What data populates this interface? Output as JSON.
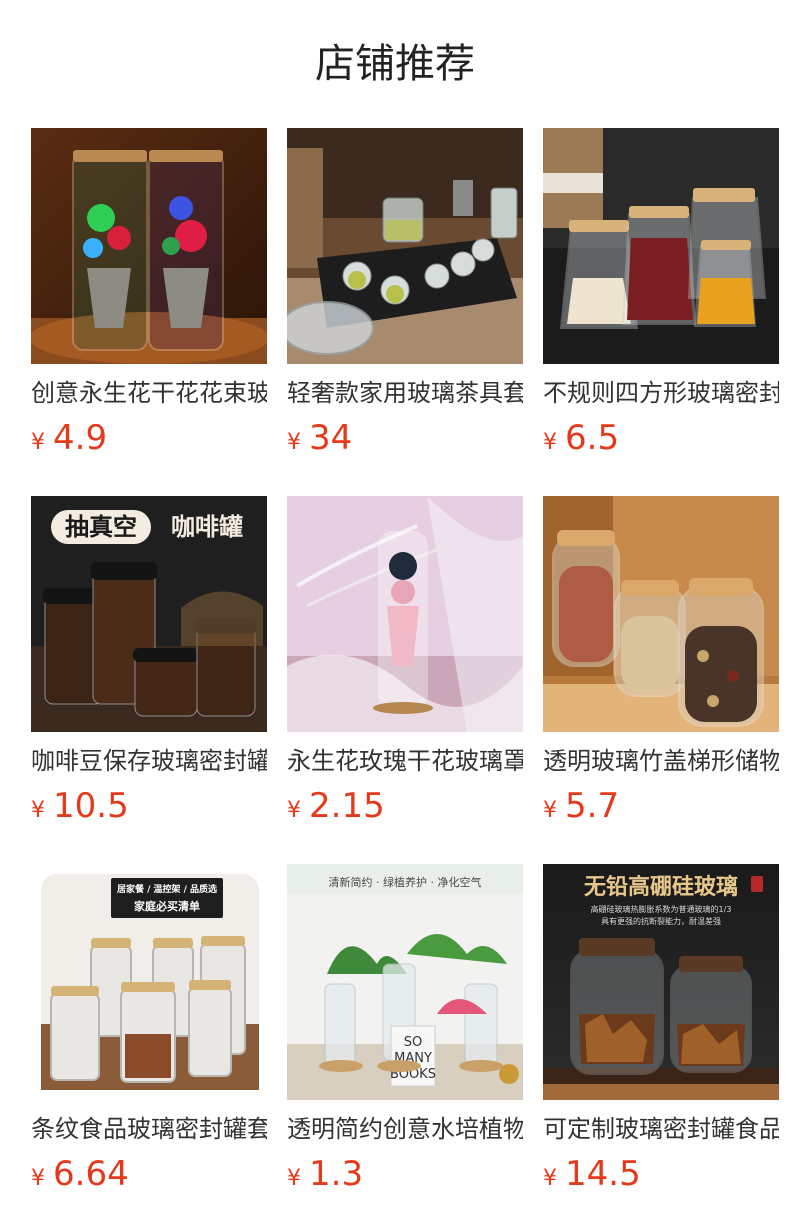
{
  "section": {
    "title": "店铺推荐"
  },
  "currency_symbol": "¥",
  "colors": {
    "price": "#e4391b",
    "text": "#333333",
    "background": "#ffffff"
  },
  "products": [
    {
      "name": "创意永生花干花花束玻璃罩",
      "price": "4.9",
      "image": "preserved-flower-bouquet-jars"
    },
    {
      "name": "轻奢款家用玻璃茶具套装",
      "price": "34",
      "image": "glass-tea-set-on-tray"
    },
    {
      "name": "不规则四方形玻璃密封罐",
      "price": "6.5",
      "image": "square-glass-jars-bamboo-lids"
    },
    {
      "name": "咖啡豆保存玻璃密封罐",
      "price": "10.5",
      "image": "coffee-bean-vacuum-jars",
      "banner_left": "抽真空",
      "banner_right": "咖啡罐"
    },
    {
      "name": "永生花玫瑰干花玻璃罩",
      "price": "2.15",
      "image": "pink-rose-in-glass-tube"
    },
    {
      "name": "透明玻璃竹盖梯形储物罐",
      "price": "5.7",
      "image": "nut-storage-jars"
    },
    {
      "name": "条纹食品玻璃密封罐套装",
      "price": "6.64",
      "image": "striped-glass-jars",
      "tag_line1": "居家餐 / 温控架 / 品质选",
      "tag_line2": "家庭必买清单"
    },
    {
      "name": "透明简约创意水培植物瓶",
      "price": "1.3",
      "image": "hydroponic-plant-vases",
      "top_text": "清新简约 · 绿植养护 · 净化空气",
      "book_text_1": "SO",
      "book_text_2": "MANY",
      "book_text_3": "BOOKS"
    },
    {
      "name": "可定制玻璃密封罐食品罐",
      "price": "14.5",
      "image": "lead-free-glass-jars",
      "headline": "无铅高硼硅玻璃",
      "subline1": "高硼硅玻璃热膨胀系数为普通玻璃的1/3",
      "subline2": "具有更强的抗断裂能力，耐温差强"
    }
  ]
}
